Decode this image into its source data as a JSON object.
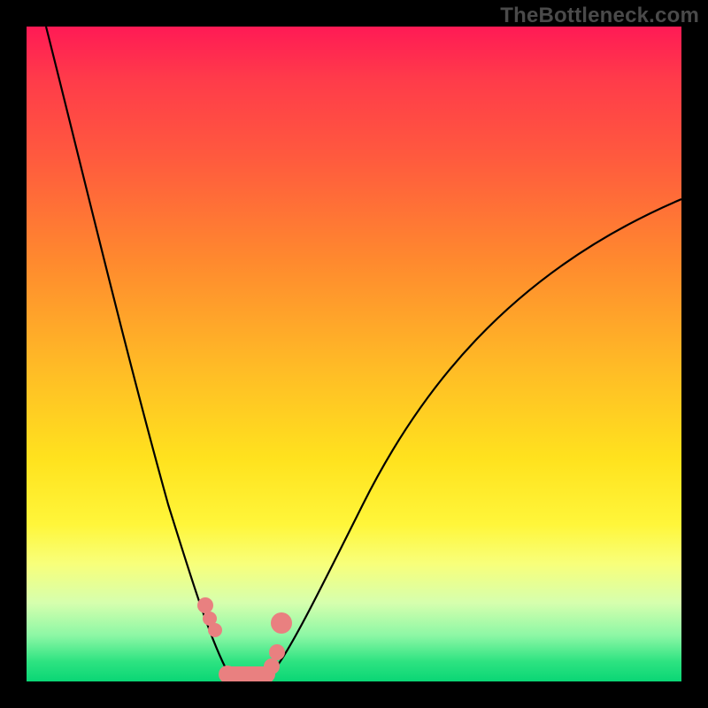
{
  "watermark": "TheBottleneck.com",
  "colors": {
    "curve": "#000000",
    "bead": "#e98080",
    "frame": "#000000"
  },
  "chart_data": {
    "type": "line",
    "title": "",
    "xlabel": "",
    "ylabel": "",
    "xlim": [
      0,
      100
    ],
    "ylim": [
      0,
      100
    ],
    "grid": false,
    "legend": false,
    "note": "V-shaped bottleneck curve over vertical red→green gradient. Y ≈ bottleneck %; minimum ≈ 0 near x ≈ 33. No axis ticks or numeric labels are rendered; values below are read from geometry.",
    "series": [
      {
        "name": "bottleneck-curve",
        "x": [
          3,
          6,
          9,
          12,
          15,
          18,
          21,
          24,
          27,
          29,
          31,
          33,
          36,
          39,
          44,
          50,
          58,
          68,
          80,
          92,
          100
        ],
        "values": [
          100,
          86,
          72,
          60,
          49,
          39,
          30,
          22,
          14,
          8,
          3,
          0,
          0,
          3,
          10,
          20,
          32,
          45,
          57,
          67,
          73
        ]
      }
    ],
    "beads": {
      "name": "highlight-points",
      "x": [
        27.0,
        27.8,
        28.6,
        30.5,
        33.0,
        35.0,
        36.3,
        37.3,
        38.0,
        38.7
      ],
      "values": [
        11.5,
        9.5,
        7.8,
        0.8,
        0.5,
        0.5,
        0.9,
        2.2,
        4.3,
        8.8
      ],
      "radius": [
        9,
        8,
        8,
        10,
        10,
        10,
        10,
        9,
        9,
        12
      ]
    }
  }
}
